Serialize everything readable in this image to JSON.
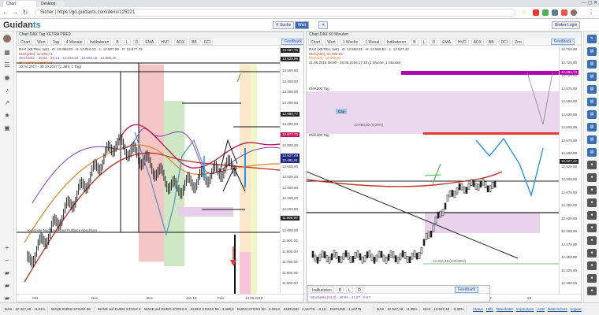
{
  "browser": {
    "tabs": [
      "Chart",
      "Desktop"
    ],
    "back": "←",
    "forward": "→",
    "reload": "↻",
    "url": "Sicher | https://go.guidants.com/de#c/125221",
    "profile_initial": "",
    "menu_icon": "⋮"
  },
  "header": {
    "logo_prefix": "Guidan",
    "logo_suffix": "ts",
    "tabs": [
      "Suche",
      "Wert"
    ],
    "broker_label": "Broker Login"
  },
  "left_chart": {
    "title": "Chart DAX Tag XETRA PRE0",
    "tools": [
      "Chart",
      "Wert",
      "Tag",
      "4 Monate",
      "Indikatoren",
      "B",
      "L",
      "Ö",
      "EMA",
      "HVD",
      "ADX",
      "BB",
      "DCI"
    ],
    "feedback": "Feedback",
    "legend": [
      {
        "text": "DAX (XETRA, last) · O: 13.058,93 · H: 13.016,13 · L: 12.807,20 · C: 12.877,73",
        "color": "#333333"
      },
      {
        "text": "EMA(200): 12.893,71",
        "color": "#c0392b"
      },
      {
        "text": "Stochastic · 28,52 · 26,13 · 12.816,18 · 13.058,28 · 12.888,20",
        "color": "#7b3fb5"
      },
      {
        "text": "EMA(200): 12.557,13",
        "color": "#e67e22"
      },
      {
        "text": "10.04.2017 - 30.10.2017 (1 Jahr, 1 Tag)",
        "color": "#333333"
      }
    ],
    "prices": [
      "13.700,00",
      "13.600,00",
      "13.500,00",
      "13.400,00",
      "13.300,00",
      "13.200,00",
      "13.100,00",
      "13.000,00",
      "12.900,00",
      "12.800,00",
      "12.700,00",
      "12.600,00",
      "12.500,00",
      "12.400,00",
      "12.300,00",
      "12.200,00",
      "12.100,00",
      "12.000,00",
      "11.900,00",
      "11.800,00",
      "11.700,00",
      "11.600,00",
      "11.500,00"
    ],
    "tags": [
      {
        "text": "13.597,76",
        "color": "#222222"
      },
      {
        "text": "13.525,96",
        "color": "#222222"
      },
      {
        "text": "12.980,77",
        "color": "#222222"
      },
      {
        "text": "12.877,73",
        "color": "#c2185b"
      },
      {
        "text": "12.527,48",
        "color": "#1a237e"
      },
      {
        "text": "12.481,91",
        "color": "#1a237e"
      },
      {
        "text": "11.868,00",
        "color": "#222222"
      }
    ],
    "time_labels": [
      "Okt",
      "Nov",
      "Dez",
      "Jan 18",
      "Feb",
      "14.05.2018"
    ],
    "annotation": "Kursziele Nachlaufe und Pullback Abschluss"
  },
  "right_chart": {
    "title": "Chart DAX 60 Minuten",
    "tools": [
      "Chart",
      "Wert",
      "1 Woche",
      "1 Monat",
      "Indikatoren",
      "B",
      "L",
      "Ö",
      "EMA",
      "HVD",
      "ADX",
      "BB",
      "DCI",
      "Zrm"
    ],
    "feedback": "Feedback",
    "legend": [
      {
        "text": "DAX (XETRA, last) · O: 12.553,81 · H: 12.559,51 · L: 12.527,42",
        "color": "#333333"
      },
      {
        "text": "EMA(200): 12.489,64",
        "color": "#c0392b"
      },
      {
        "text": "EMA(50): 12.560,93",
        "color": "#e67e22"
      },
      {
        "text": "21.06.2018 08:00 - 28.06.2018 17:30 (1 Woche, 1 Stunde)",
        "color": "#333333"
      }
    ],
    "prices": [
      "12.750,00",
      "12.725,00",
      "12.700,00",
      "12.675,00",
      "12.650,00",
      "12.625,00",
      "12.600,00",
      "12.575,00",
      "12.550,00",
      "12.525,00",
      "12.500,00",
      "12.475,00",
      "12.450,00",
      "12.425,00",
      "12.400,00",
      "12.375,00",
      "12.350,00",
      "12.325,00",
      "12.300,00"
    ],
    "tags": [
      {
        "text": "12.684,73",
        "color": "#b000b0"
      },
      {
        "text": "12.527,42",
        "color": "#222222"
      }
    ],
    "zone_label_1": "EMA200 Tag",
    "zone_label_2": "EMA200 Tag",
    "zone_small": "Gap",
    "level_label_1": "12.550,00 (0,00%)",
    "level_label_2": "12.344,40 (100,00%)",
    "time_labels": [
      "21",
      "22",
      "25",
      "26",
      "27",
      "28"
    ]
  },
  "mini_panel": {
    "tools": [
      "Indikatoren",
      "B",
      "L",
      "Ö"
    ],
    "feedback": "Feedback",
    "legend": "Stochastic(14,3) · 40,91 · 41,57 · 0,67"
  },
  "bottom_tickers": [
    "DAX · 12.327,49 · -0,01%",
    "WAVE EURO STOXX 50",
    "WAVE auf EURO STOXX 50",
    "WAVE auf EURO STOXX 50",
    "EURO STOXX 50 · 3.409,65 · -0,07%",
    "EURO STOXX 50 · 3.409,60",
    "EURUSD · 1,16776 · -0,11%",
    "EURUSD · 1,16776",
    "DAX · 12.527,42 · -0,39%",
    "DAX · 12.527,42 · -0,39%"
  ],
  "bottom_right": [
    "Status",
    "Hilfe",
    "Newsletter",
    "Impressum",
    "AGB",
    "Datenschutz",
    "Logout"
  ],
  "colors": {
    "accent": "#2a8bd2",
    "magenta": "#b000b0",
    "ema200": "#c0392b",
    "zone_pink": "#f4c6c6",
    "zone_green": "#cfe8c4",
    "zone_lilac": "#e6cdea"
  }
}
